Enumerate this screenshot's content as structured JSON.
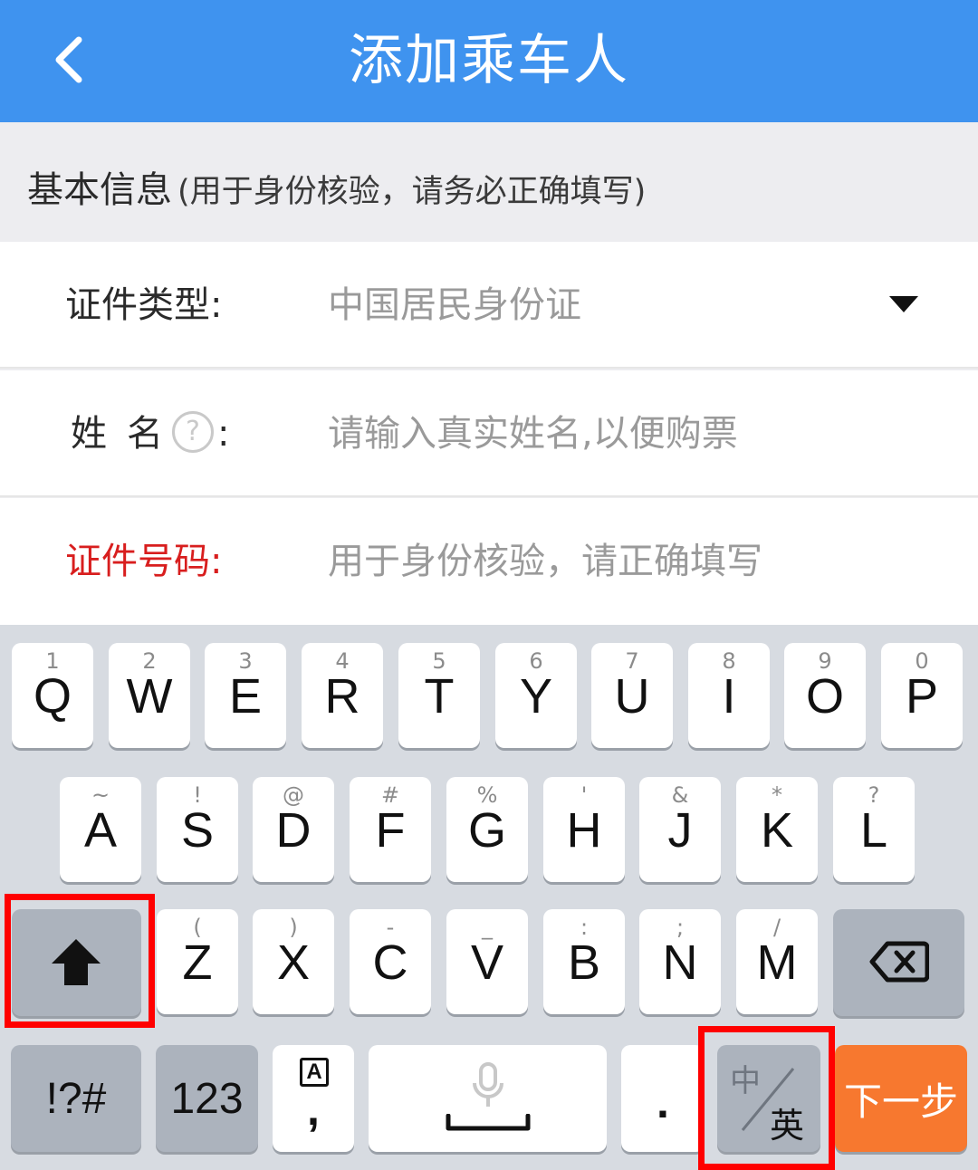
{
  "header": {
    "title": "添加乘车人"
  },
  "section": {
    "title": "基本信息",
    "note": "(用于身份核验，请务必正确填写)"
  },
  "fields": {
    "id_type": {
      "label": "证件类型:",
      "value": "中国居民身份证"
    },
    "name": {
      "label_a": "姓",
      "label_b": "名",
      "help": "?",
      "colon": ":",
      "placeholder": "请输入真实姓名,以便购票"
    },
    "id_number": {
      "label": "证件号码:",
      "placeholder": "用于身份核验，请正确填写"
    }
  },
  "keyboard": {
    "row1": [
      {
        "sub": "1",
        "key": "Q"
      },
      {
        "sub": "2",
        "key": "W"
      },
      {
        "sub": "3",
        "key": "E"
      },
      {
        "sub": "4",
        "key": "R"
      },
      {
        "sub": "5",
        "key": "T"
      },
      {
        "sub": "6",
        "key": "Y"
      },
      {
        "sub": "7",
        "key": "U"
      },
      {
        "sub": "8",
        "key": "I"
      },
      {
        "sub": "9",
        "key": "O"
      },
      {
        "sub": "0",
        "key": "P"
      }
    ],
    "row2": [
      {
        "sub": "~",
        "key": "A"
      },
      {
        "sub": "!",
        "key": "S"
      },
      {
        "sub": "@",
        "key": "D"
      },
      {
        "sub": "#",
        "key": "F"
      },
      {
        "sub": "%",
        "key": "G"
      },
      {
        "sub": "'",
        "key": "H"
      },
      {
        "sub": "&",
        "key": "J"
      },
      {
        "sub": "*",
        "key": "K"
      },
      {
        "sub": "?",
        "key": "L"
      }
    ],
    "row3": [
      {
        "sub": "(",
        "key": "Z"
      },
      {
        "sub": ")",
        "key": "X"
      },
      {
        "sub": "-",
        "key": "C"
      },
      {
        "sub": "_",
        "key": "V"
      },
      {
        "sub": ":",
        "key": "B"
      },
      {
        "sub": ";",
        "key": "N"
      },
      {
        "sub": "/",
        "key": "M"
      }
    ],
    "symbols": "!?#",
    "numbers": "123",
    "ime_letter": "A",
    "comma": ",",
    "period": ".",
    "lang_zh": "中",
    "lang_en": "英",
    "next": "下一步"
  },
  "colors": {
    "header": "#3f93ef",
    "label_required": "#d81e1e",
    "next_key": "#f7782f",
    "highlight": "#ff0000"
  },
  "icons": {
    "back": "chevron-left-icon",
    "dropdown": "caret-down-icon",
    "help": "question-circle-icon",
    "shift": "shift-arrow-icon",
    "backspace": "backspace-icon",
    "mic": "microphone-icon"
  }
}
